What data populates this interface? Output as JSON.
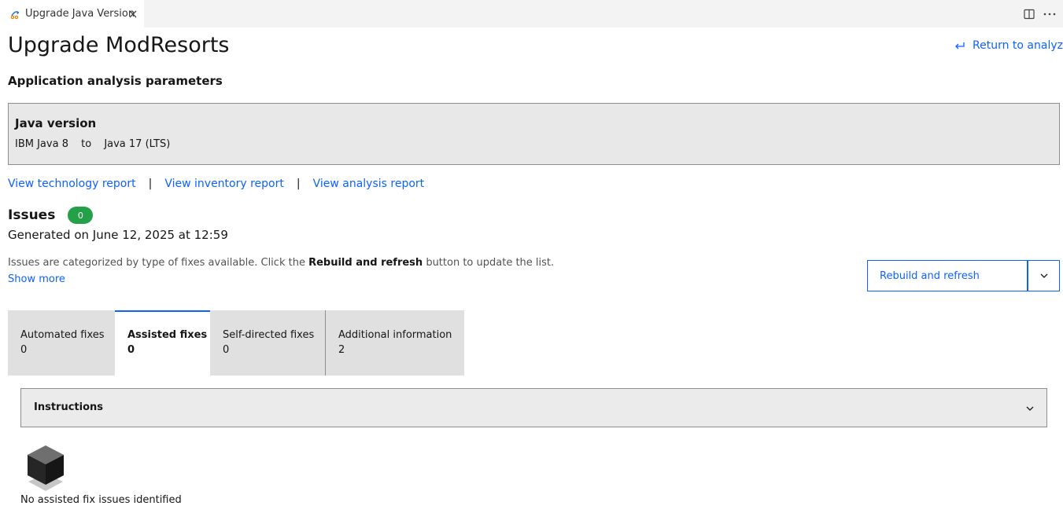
{
  "editor_tab": {
    "title": "Upgrade Java Version"
  },
  "header": {
    "title": "Upgrade ModResorts",
    "return_label": "Return to analyze"
  },
  "params": {
    "section_title": "Application analysis parameters",
    "java_label": "Java version",
    "from": "IBM Java 8",
    "to_word": "to",
    "to": "Java 17 (LTS)"
  },
  "reports": {
    "technology": "View technology report",
    "inventory": "View inventory report",
    "analysis": "View analysis report",
    "separator": "|"
  },
  "issues": {
    "title": "Issues",
    "count": "0",
    "generated": "Generated on June 12, 2025 at 12:59",
    "desc_before": "Issues are categorized by type of fixes available. Click the ",
    "desc_bold": "Rebuild and refresh",
    "desc_after": " button to update the list.",
    "show_more": "Show more",
    "rebuild_label": "Rebuild and refresh"
  },
  "tabs": [
    {
      "label": "Automated fixes",
      "count": "0"
    },
    {
      "label": "Assisted fixes",
      "count": "0"
    },
    {
      "label": "Self-directed fixes",
      "count": "0"
    },
    {
      "label": "Additional information",
      "count": "2"
    }
  ],
  "instructions": {
    "label": "Instructions"
  },
  "empty_state": {
    "text": "No assisted fix issues identified"
  },
  "colors": {
    "link": "#0f62fe",
    "badge": "#24a148",
    "tab_bg": "#e0e0e0",
    "panel_bg": "#e8e8e8"
  },
  "icons": [
    "java-upgrade-icon",
    "close-icon",
    "split-editor-icon",
    "more-actions-icon",
    "return-arrow-icon",
    "chevron-down-icon",
    "empty-box-icon"
  ]
}
